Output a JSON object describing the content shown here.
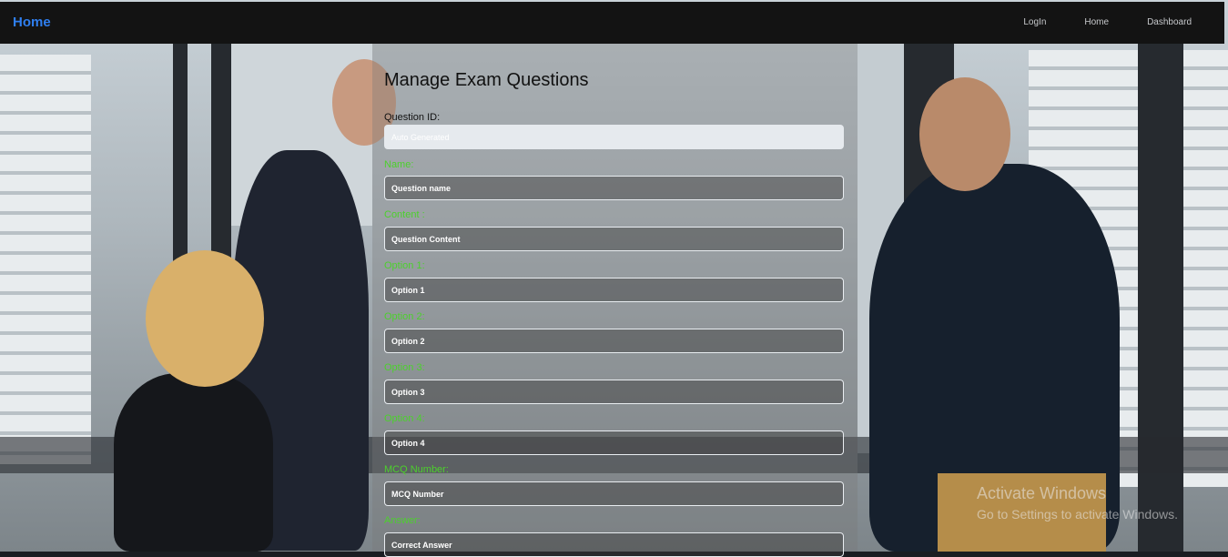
{
  "navbar": {
    "brand": "Home",
    "links": [
      "LogIn",
      "Home",
      "Dashboard"
    ]
  },
  "form": {
    "title": "Manage Exam Questions",
    "fields": [
      {
        "label": "Question ID:",
        "placeholder": "Auto Generated",
        "readonly": true
      },
      {
        "label": "Name:",
        "placeholder": "Question name"
      },
      {
        "label": "Content :",
        "placeholder": "Question Content"
      },
      {
        "label": "Option 1:",
        "placeholder": "Option 1"
      },
      {
        "label": "Option 2:",
        "placeholder": "Option 2"
      },
      {
        "label": "Option 3:",
        "placeholder": "Option 3"
      },
      {
        "label": "Option 4:",
        "placeholder": "Option 4"
      },
      {
        "label": "MCQ Number:",
        "placeholder": "MCQ Number"
      },
      {
        "label": "Answer:",
        "placeholder": "Correct Answer"
      }
    ]
  },
  "watermark": {
    "line1": "Activate Windows",
    "line2": "Go to Settings to activate Windows."
  },
  "colors": {
    "brand": "#2f7ff0",
    "label_green": "#4cd12c",
    "navbar": "#131313"
  }
}
